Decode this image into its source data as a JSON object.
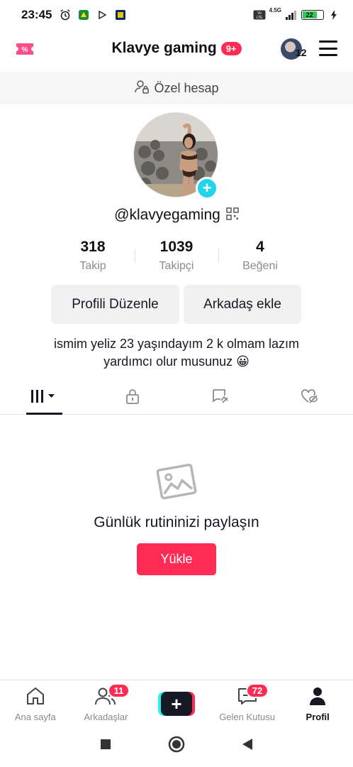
{
  "status_bar": {
    "time": "23:45",
    "network": "4.5G",
    "battery": "22"
  },
  "header": {
    "title": "Klavye gaming",
    "notification_badge": "9+",
    "accounts_count": "12"
  },
  "private_banner": {
    "text": "Özel hesap"
  },
  "profile": {
    "username": "@klavyegaming",
    "stats": [
      {
        "value": "318",
        "label": "Takip"
      },
      {
        "value": "1039",
        "label": "Takipçi"
      },
      {
        "value": "4",
        "label": "Beğeni"
      }
    ],
    "edit_button": "Profili Düzenle",
    "add_friend_button": "Arkadaş ekle",
    "bio_line1": "ismim yeliz 23 yaşındayım 2 k olmam lazım",
    "bio_line2": "yardımcı olur musunuz 😀"
  },
  "empty_state": {
    "title": "Günlük rutininizi paylaşın",
    "upload_button": "Yükle"
  },
  "bottom_nav": {
    "home": "Ana sayfa",
    "friends": "Arkadaşlar",
    "friends_badge": "11",
    "inbox": "Gelen Kutusu",
    "inbox_badge": "72",
    "profile": "Profil"
  },
  "colors": {
    "accent": "#fe2c55",
    "cyan": "#20d5ec"
  }
}
